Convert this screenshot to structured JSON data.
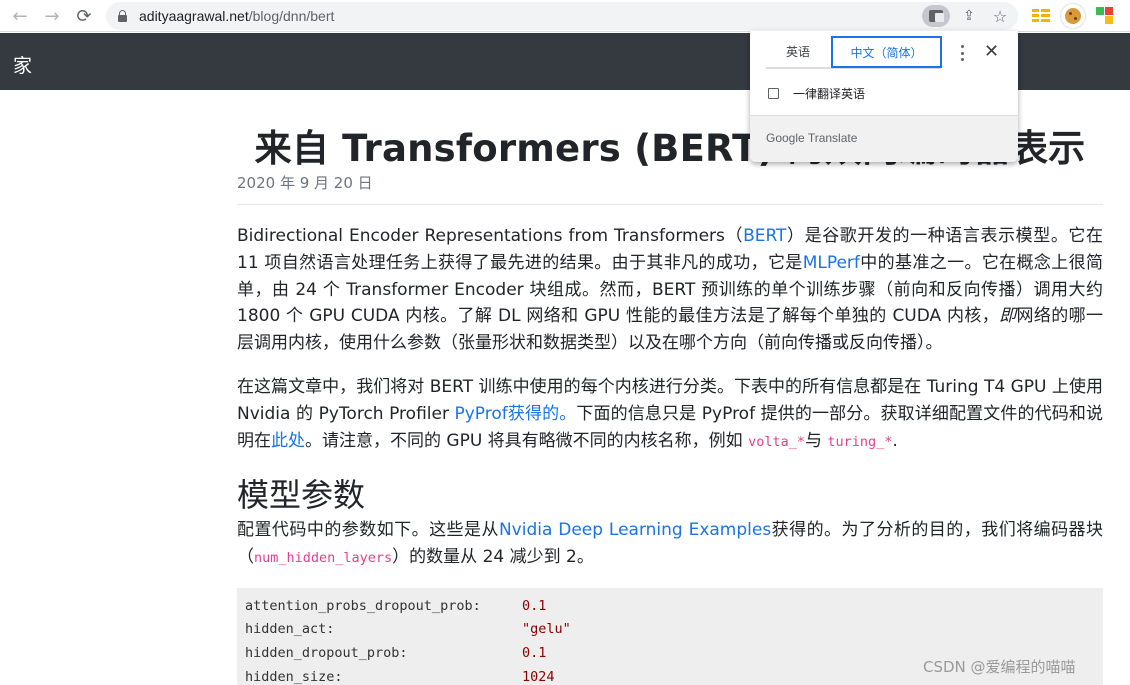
{
  "browser": {
    "url_host": "adityaagrawal.net",
    "url_path": "/blog/dnn/bert",
    "icons": {
      "back": "←",
      "forward": "→",
      "reload": "⟳",
      "share": "⇪",
      "star": "☆"
    }
  },
  "site": {
    "brand": "家"
  },
  "article": {
    "title": "来自 Transformers (BERT) 的双向编码器表示",
    "date": "2020 年 9 月 20 日",
    "p1": {
      "t1": "Bidirectional Encoder Representations from Transformers（",
      "link_bert": "BERT",
      "t2": "）是谷歌开发的一种语言表示模型。它在 11 项自然语言处理任务上获得了最先进的结果。由于其非凡的成功，它是",
      "link_mlperf": "MLPerf",
      "t3": "中的基准之一。它在概念上很简单，由 24 个 Transformer Encoder 块组成。然而，BERT 预训练的单个训练步骤（前向和反向传播）调用大约 1800 个 GPU CUDA 内核。了解 DL 网络和 GPU 性能的最佳方法是了解每个单独的 CUDA 内核，",
      "em": "即",
      "t4": "网络的哪一层调用内核，使用什么参数（张量形状和数据类型）以及在哪个方向（前向传播或反向传播）。"
    },
    "p2": {
      "t1": "在这篇文章中，我们将对 BERT 训练中使用的每个内核进行分类。下表中的所有信息都是在 Turing T4 GPU 上使用 Nvidia 的 PyTorch Profiler ",
      "link_pyprof": "PyProf获得的。",
      "t2": "下面的信息只是 PyProf 提供的一部分。获取详细配置文件的代码和说明在",
      "link_here": "此处",
      "t3": "。请注意，不同的 GPU 将具有略微不同的内核名称，例如 ",
      "code1": "volta_*",
      "t4": "与 ",
      "code2": "turing_*",
      "t5": "."
    },
    "h2": "模型参数",
    "p3": {
      "t1": "配置代码中的参数如下。这些是从",
      "link_examples": "Nvidia Deep Learning Examples",
      "t2": "获得的。为了分析的目的，我们将编码器块（",
      "code": "num_hidden_layers",
      "t3": "）的数量从 24 减少到 2。"
    },
    "config": [
      {
        "key": "attention_probs_dropout_prob:",
        "value": "0.1"
      },
      {
        "key": "hidden_act:",
        "value": "\"gelu\""
      },
      {
        "key": "hidden_dropout_prob:",
        "value": "0.1"
      },
      {
        "key": "hidden_size:",
        "value": "1024"
      }
    ]
  },
  "translate_popup": {
    "tab_source": "英语",
    "tab_target": "中文（简体）",
    "always_translate": "一律翻译英语",
    "always_checked": false,
    "footer": "Google Translate",
    "close": "✕"
  },
  "watermark": "CSDN @爱编程的喵喵",
  "colors": {
    "link": "#1a73e8",
    "navbar": "#343a40",
    "inline_code": "#e83e8c",
    "code_value": "#8b0000",
    "popup_accent": "#1a73e8"
  }
}
